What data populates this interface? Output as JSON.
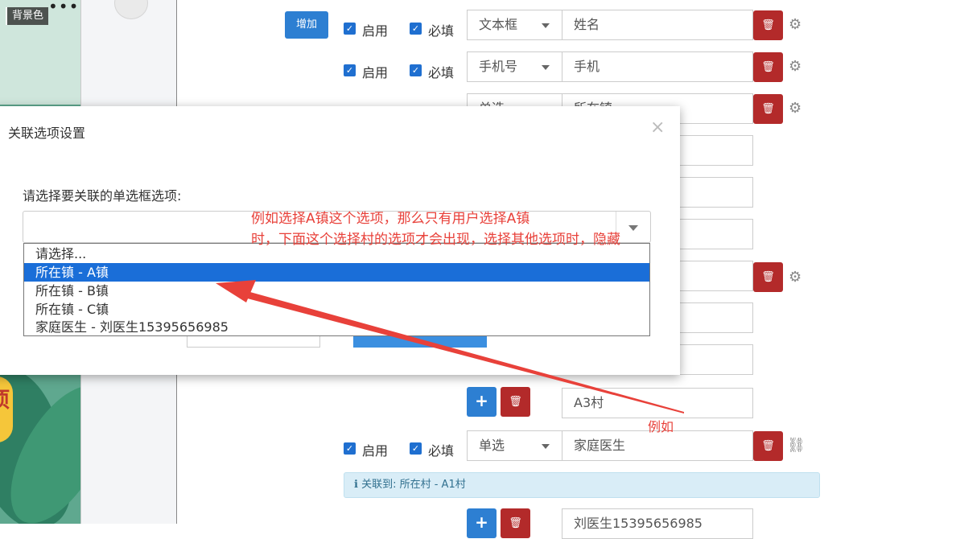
{
  "preview": {
    "bg_color_tag": "背景色",
    "badge_char": "项"
  },
  "toolbar": {
    "add_label": "增加"
  },
  "rows": [
    {
      "enable": "启用",
      "required": "必填",
      "type": "文本框",
      "value": "姓名"
    },
    {
      "enable": "启用",
      "required": "必填",
      "type": "手机号",
      "value": "手机"
    },
    {
      "type": "单选",
      "value": "所在镇"
    },
    {
      "value": "A3村"
    },
    {
      "enable": "启用",
      "required": "必填",
      "type": "单选",
      "value": "家庭医生"
    },
    {
      "value": "刘医生15395656985"
    }
  ],
  "info_bar": {
    "text": "关联到: 所在村 - A1村"
  },
  "modal": {
    "title": "关联选项设置",
    "close": "×",
    "prompt": "请选择要关联的单选框选项:",
    "options": [
      "请选择...",
      "所在镇 - A镇",
      "所在镇 - B镇",
      "所在镇 - C镇",
      "家庭医生 - 刘医生15395656985"
    ],
    "selected_index": 1
  },
  "annotations": {
    "line1": "例如选择A镇这个选项，那么只有用户选择A镇",
    "line2": "时，下面这个选择村的选项才会出现，选择其他选项时，隐藏",
    "small": "例如"
  },
  "colors": {
    "accent": "#2d7fd2",
    "danger": "#b32a2a",
    "annotation": "#e8413a",
    "selected_option": "#1a6ed8"
  }
}
